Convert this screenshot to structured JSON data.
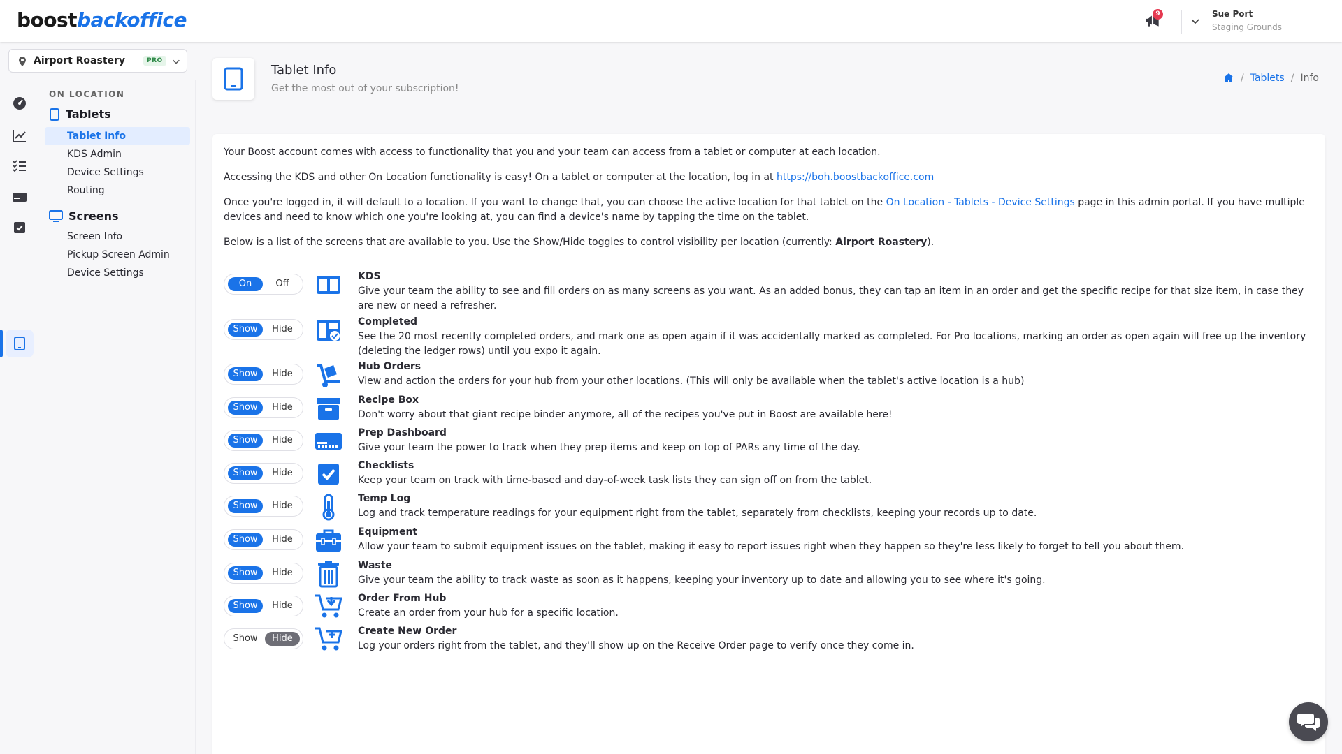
{
  "app": {
    "logo_part1": "boost",
    "logo_part2": "backoffice"
  },
  "header": {
    "notification_count": "9",
    "user_name": "Sue Port",
    "user_org": "Staging Grounds"
  },
  "location": {
    "name": "Airport Roastery",
    "badge": "PRO"
  },
  "subnav": {
    "section": "ON LOCATION",
    "groups": [
      {
        "label": "Tablets",
        "items": [
          "Tablet Info",
          "KDS Admin",
          "Device Settings",
          "Routing"
        ]
      },
      {
        "label": "Screens",
        "items": [
          "Screen Info",
          "Pickup Screen Admin",
          "Device Settings"
        ]
      }
    ]
  },
  "page": {
    "title": "Tablet Info",
    "subtitle": "Get the most out of your subscription!",
    "breadcrumb": [
      "Tablets",
      "Info"
    ]
  },
  "intro": {
    "p1": "Your Boost account comes with access to functionality that you and your team can access from a tablet or computer at each location.",
    "p2_text": "Accessing the KDS and other On Location functionality is easy! On a tablet or computer at the location, log in at ",
    "p2_link": "https://boh.boostbackoffice.com",
    "p3_pre": "Once you're logged in, it will default to a location. If you want to change that, you can choose the active location for that tablet on the ",
    "p3_link": "On Location - Tablets - Device Settings",
    "p3_post": " page in this admin portal. If you have multiple devices and need to know which one you're looking at, you can find a device's name by tapping the time on the tablet.",
    "p4_pre": "Below is a list of the screens that are available to you. Use the Show/Hide toggles to control visibility per location (currently: ",
    "p4_bold": "Airport Roastery",
    "p4_post": ")."
  },
  "features": [
    {
      "title": "KDS",
      "toggle": [
        "On",
        "Off"
      ],
      "selected": 0,
      "icon": "columns-icon",
      "desc": "Give your team the ability to see and fill orders on as many screens as you want. As an added bonus, they can tap an item in an order and get the specific recipe for that size item, in case they are new or need a refresher."
    },
    {
      "title": "Completed",
      "toggle": [
        "Show",
        "Hide"
      ],
      "selected": 0,
      "icon": "completed-board-icon",
      "desc": "See the 20 most recently completed orders, and mark one as open again if it was accidentally marked as completed. For Pro locations, marking an order as open again will free up the inventory (deleting the ledger rows) until you expo it again."
    },
    {
      "title": "Hub Orders",
      "toggle": [
        "Show",
        "Hide"
      ],
      "selected": 0,
      "icon": "dolly-icon",
      "desc": "View and action the orders for your hub from your other locations. (This will only be available when the tablet's active location is a hub)"
    },
    {
      "title": "Recipe Box",
      "toggle": [
        "Show",
        "Hide"
      ],
      "selected": 0,
      "icon": "archive-box-icon",
      "desc": "Don't worry about that giant recipe binder anymore, all of the recipes you've put in Boost are available here!"
    },
    {
      "title": "Prep Dashboard",
      "toggle": [
        "Show",
        "Hide"
      ],
      "selected": 0,
      "icon": "dashboard-icon",
      "desc": "Give your team the power to track when they prep items and keep on top of PARs any time of the day."
    },
    {
      "title": "Checklists",
      "toggle": [
        "Show",
        "Hide"
      ],
      "selected": 0,
      "icon": "checkbox-icon",
      "desc": "Keep your team on track with time-based and day-of-week task lists they can sign off on from the tablet."
    },
    {
      "title": "Temp Log",
      "toggle": [
        "Show",
        "Hide"
      ],
      "selected": 0,
      "icon": "thermometer-icon",
      "desc": "Log and track temperature readings for your equipment right from the tablet, separately from checklists, keeping your records up to date."
    },
    {
      "title": "Equipment",
      "toggle": [
        "Show",
        "Hide"
      ],
      "selected": 0,
      "icon": "toolbox-icon",
      "desc": "Allow your team to submit equipment issues on the tablet, making it easy to report issues right when they happen so they're less likely to forget to tell you about them."
    },
    {
      "title": "Waste",
      "toggle": [
        "Show",
        "Hide"
      ],
      "selected": 0,
      "icon": "trash-icon",
      "desc": "Give your team the ability to track waste as soon as it happens, keeping your inventory up to date and allowing you to see where it's going."
    },
    {
      "title": "Order From Hub",
      "toggle": [
        "Show",
        "Hide"
      ],
      "selected": 0,
      "icon": "cart-download-icon",
      "desc": "Create an order from your hub for a specific location."
    },
    {
      "title": "Create New Order",
      "toggle": [
        "Show",
        "Hide"
      ],
      "selected": 1,
      "icon": "cart-plus-icon",
      "desc": "Log your orders right from the tablet, and they'll show up on the Receive Order page to verify once they come in."
    }
  ],
  "colors": {
    "accent": "#1a73e8",
    "badge_red": "#e53950",
    "pro_green": "#2f8a48"
  }
}
